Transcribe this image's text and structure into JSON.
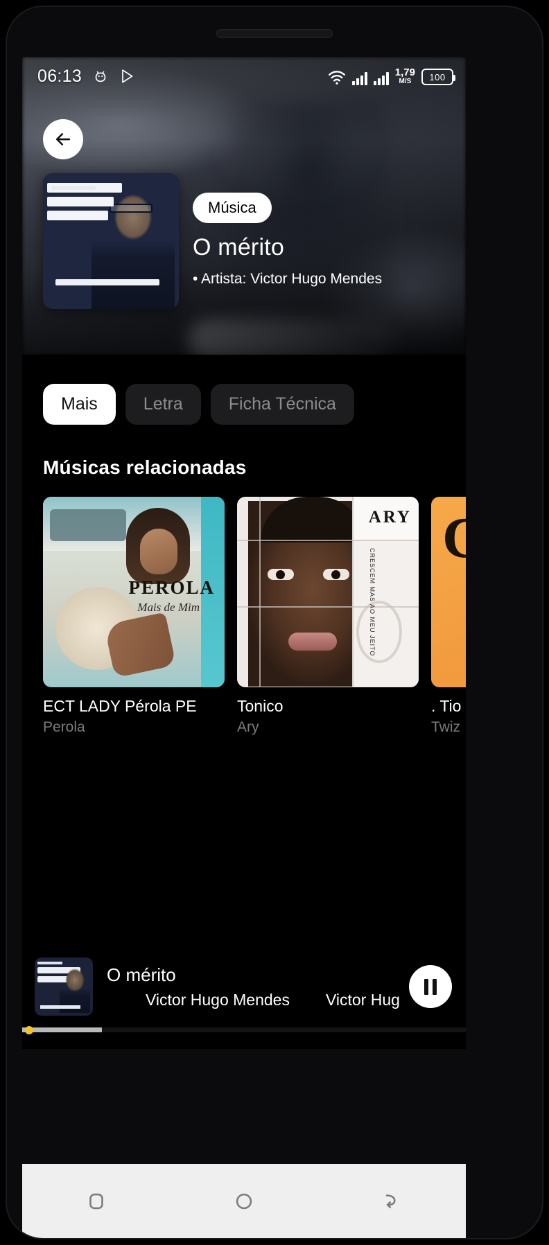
{
  "status_bar": {
    "time": "06:13",
    "icons": [
      "android-robot-icon",
      "play-store-icon"
    ],
    "wifi_icon": "wifi-icon",
    "signal_icons": [
      "signal-bars-icon",
      "signal-bars-icon"
    ],
    "net_speed_value": "1,79",
    "net_speed_unit": "M/S",
    "battery_level": "100"
  },
  "hero": {
    "back_icon": "arrow-left-icon",
    "badge": "Música",
    "title": "O mérito",
    "artist": "• Artista: Victor Hugo Mendes",
    "album_art_lines": [
      "Os Segredos",
      "das Mulheres",
      "Brasileiras"
    ],
    "album_art_kicker": "recomendado"
  },
  "tabs": [
    {
      "label": "Mais",
      "active": true
    },
    {
      "label": "Letra",
      "active": false
    },
    {
      "label": "Ficha Técnica",
      "active": false
    }
  ],
  "section": {
    "title": "Músicas relacionadas"
  },
  "cards": [
    {
      "title": "ECT LADY        Pérola  PE",
      "subtitle": "Perola",
      "art_brand": "PEROLA",
      "art_sub": "Mais de Mim"
    },
    {
      "title": "Tonico",
      "subtitle": "Ary",
      "art_brand": "ARY",
      "art_sub": "CRESCEM MAS AO MEU JEITO"
    },
    {
      "title": ". Tio",
      "subtitle": "Twiz",
      "art_brand": "C",
      "art_sub": ""
    }
  ],
  "player": {
    "title": "O mérito",
    "marquee": [
      "Victor Hugo Mendes",
      "Victor Hug"
    ],
    "button_icon": "pause-icon",
    "progress_percent": 18,
    "knob_color": "#f3c42b",
    "fill_color": "#b9b9b9"
  },
  "nav_bar": {
    "buttons": [
      "recents-square-icon",
      "home-circle-icon",
      "back-arrow-icon"
    ]
  }
}
